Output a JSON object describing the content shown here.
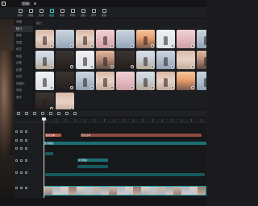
{
  "app": {
    "title_chip": "剪映",
    "title": ""
  },
  "toolbar": {
    "items": [
      {
        "label": "媒体",
        "icon": "media-icon",
        "active": false
      },
      {
        "label": "音频",
        "icon": "audio-icon",
        "active": false
      },
      {
        "label": "文本",
        "icon": "text-icon",
        "active": false
      },
      {
        "label": "贴纸",
        "icon": "sticker-icon",
        "active": true
      },
      {
        "label": "特效",
        "icon": "effects-icon",
        "active": false
      },
      {
        "label": "转场",
        "icon": "transition-icon",
        "active": false
      },
      {
        "label": "滤镜",
        "icon": "filter-icon",
        "active": false
      },
      {
        "label": "调节",
        "icon": "adjust-icon",
        "active": false
      },
      {
        "label": "模板",
        "icon": "template-icon",
        "active": false
      }
    ]
  },
  "categories": [
    "收藏",
    "热门",
    "推荐",
    "氛围",
    "综艺",
    "情绪",
    "边框",
    "纹理",
    "自然",
    "风格化",
    "其他",
    "更多"
  ],
  "grid": {
    "heading": "热门",
    "thumbs": [
      "warm",
      "sea",
      "warm",
      "pink",
      "sea",
      "sun",
      "pale",
      "pink",
      "sea",
      "beach",
      "dark",
      "pale",
      "dusk",
      "dark",
      "beach",
      "sea",
      "warm",
      "dusk",
      "pale",
      "dark",
      "sea",
      "warm",
      "pink",
      "beach",
      "warm",
      "sun",
      "sea",
      "dark",
      "warm"
    ]
  },
  "timeline": {
    "text_clip_1": "默认文本",
    "text_clip_2": "默认文本",
    "audio_clip_1": "文字朗读",
    "audio_clip_2": "文字朗读",
    "video_clip": "视频素材"
  },
  "colors": {
    "accent": "#3ad2cc",
    "text_clip": "#b65b48",
    "audio_clip": "#1c6f73"
  }
}
